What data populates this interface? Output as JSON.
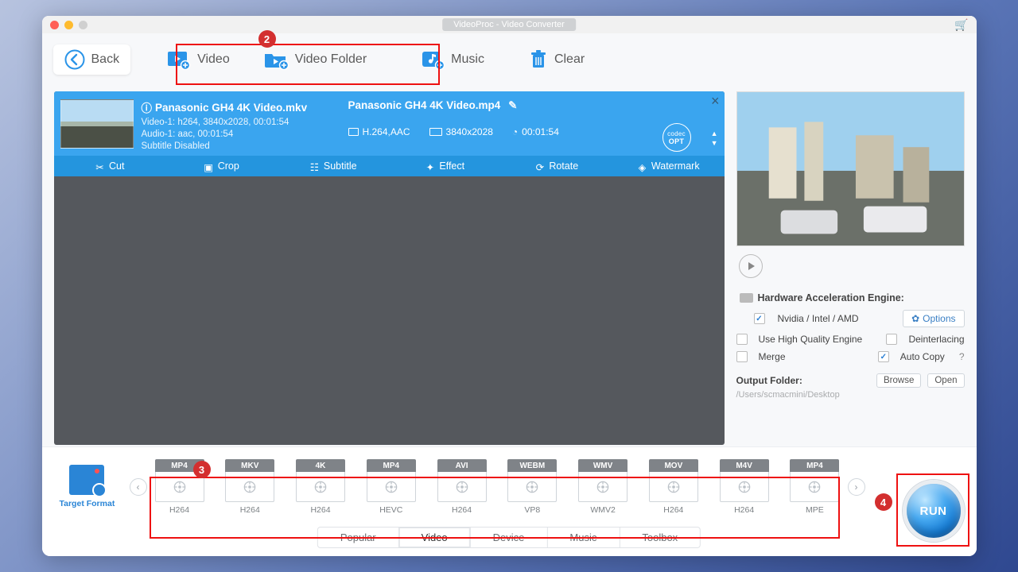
{
  "title": "VideoProc - Video Converter",
  "toolbar": {
    "back": "Back",
    "video": "Video",
    "folder": "Video Folder",
    "music": "Music",
    "clear": "Clear"
  },
  "item": {
    "source_name": "Panasonic GH4 4K Video.mkv",
    "video_line": "Video-1: h264, 3840x2028, 00:01:54",
    "audio_line": "Audio-1: aac, 00:01:54",
    "subtitle_line": "Subtitle Disabled",
    "output_name": "Panasonic GH4 4K Video.mp4",
    "codec": "H.264,AAC",
    "resolution": "3840x2028",
    "duration": "00:01:54",
    "opt_label_top": "codec",
    "opt_label": "OPT"
  },
  "tools": {
    "cut": "Cut",
    "crop": "Crop",
    "subtitle": "Subtitle",
    "effect": "Effect",
    "rotate": "Rotate",
    "watermark": "Watermark"
  },
  "right": {
    "hw_title": "Hardware Acceleration Engine:",
    "nvidia": "Nvidia / Intel / AMD",
    "options": "Options",
    "hq": "Use High Quality Engine",
    "deint": "Deinterlacing",
    "merge": "Merge",
    "autocopy": "Auto Copy",
    "outfolder_label": "Output Folder:",
    "browse": "Browse",
    "open": "Open",
    "path": "/Users/scmacmini/Desktop"
  },
  "target_label": "Target Format",
  "formats": [
    {
      "top": "MP4",
      "sub": "H264"
    },
    {
      "top": "MKV",
      "sub": "H264"
    },
    {
      "top": "4K",
      "sub": "H264"
    },
    {
      "top": "MP4",
      "sub": "HEVC"
    },
    {
      "top": "AVI",
      "sub": "H264"
    },
    {
      "top": "WEBM",
      "sub": "VP8"
    },
    {
      "top": "WMV",
      "sub": "WMV2"
    },
    {
      "top": "MOV",
      "sub": "H264"
    },
    {
      "top": "M4V",
      "sub": "H264"
    },
    {
      "top": "MP4",
      "sub": "MPE"
    }
  ],
  "tabs": [
    "Popular",
    "Video",
    "Device",
    "Music",
    "Toolbox"
  ],
  "active_tab": 1,
  "run_label": "RUN",
  "annotations": {
    "a2": "2",
    "a3": "3",
    "a4": "4"
  }
}
